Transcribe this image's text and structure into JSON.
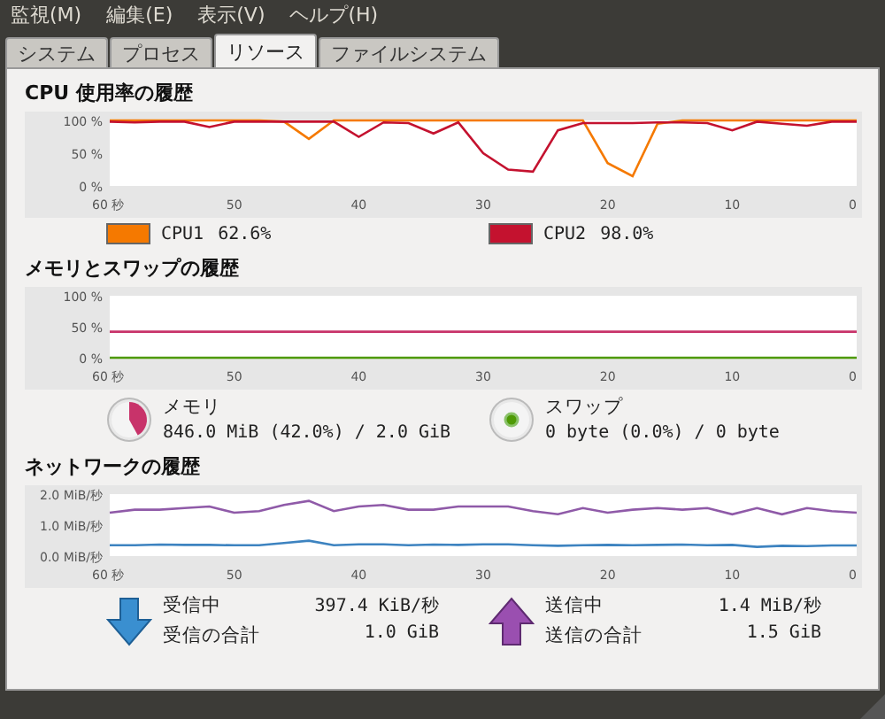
{
  "menu": [
    {
      "label": "監視(M)"
    },
    {
      "label": "編集(E)"
    },
    {
      "label": "表示(V)"
    },
    {
      "label": "ヘルプ(H)"
    }
  ],
  "tabs": [
    {
      "label": "システム",
      "selected": false
    },
    {
      "label": "プロセス",
      "selected": false
    },
    {
      "label": "リソース",
      "selected": true
    },
    {
      "label": "ファイルシステム",
      "selected": false
    }
  ],
  "cpu": {
    "title": "CPU 使用率の履歴",
    "chart_data": {
      "type": "line",
      "x": [
        60,
        58,
        56,
        54,
        52,
        50,
        48,
        46,
        44,
        42,
        40,
        38,
        36,
        34,
        32,
        30,
        28,
        26,
        24,
        22,
        20,
        18,
        16,
        14,
        12,
        10,
        8,
        6,
        4,
        2,
        0
      ],
      "xlim": [
        60,
        0
      ],
      "ylim": [
        0,
        100
      ],
      "xticks": [
        {
          "value": 60,
          "label": "60 秒"
        },
        {
          "value": 50,
          "label": "50"
        },
        {
          "value": 40,
          "label": "40"
        },
        {
          "value": 30,
          "label": "30"
        },
        {
          "value": 20,
          "label": "20"
        },
        {
          "value": 10,
          "label": "10"
        },
        {
          "value": 0,
          "label": "0"
        }
      ],
      "yticks": [
        {
          "value": 0,
          "label": "0 %"
        },
        {
          "value": 50,
          "label": "50 %"
        },
        {
          "value": 100,
          "label": "100 %"
        }
      ],
      "series": [
        {
          "name": "CPU1",
          "color": "#f57900",
          "values": [
            100,
            100,
            100,
            100,
            100,
            100,
            100,
            98,
            72,
            100,
            100,
            100,
            100,
            100,
            100,
            100,
            100,
            100,
            100,
            100,
            35,
            15,
            95,
            100,
            100,
            100,
            100,
            100,
            100,
            100,
            100
          ]
        },
        {
          "name": "CPU2",
          "color": "#c4122f",
          "values": [
            98,
            97,
            98,
            98,
            90,
            98,
            98,
            98,
            98,
            98,
            75,
            97,
            96,
            80,
            97,
            50,
            25,
            22,
            85,
            96,
            96,
            96,
            97,
            97,
            96,
            85,
            98,
            95,
            92,
            98,
            98
          ]
        }
      ]
    },
    "legend": [
      {
        "reading": "62.6%"
      },
      {
        "reading": "98.0%"
      }
    ]
  },
  "memory": {
    "title": "メモリとスワップの履歴",
    "chart_data": {
      "type": "line",
      "x": [
        60,
        0
      ],
      "xlim": [
        60,
        0
      ],
      "ylim": [
        0,
        100
      ],
      "xticks": [
        {
          "value": 60,
          "label": "60 秒"
        },
        {
          "value": 50,
          "label": "50"
        },
        {
          "value": 40,
          "label": "40"
        },
        {
          "value": 30,
          "label": "30"
        },
        {
          "value": 20,
          "label": "20"
        },
        {
          "value": 10,
          "label": "10"
        },
        {
          "value": 0,
          "label": "0"
        }
      ],
      "yticks": [
        {
          "value": 0,
          "label": "0 %"
        },
        {
          "value": 50,
          "label": "50 %"
        },
        {
          "value": 100,
          "label": "100 %"
        }
      ],
      "series": [
        {
          "name": "メモリ",
          "color": "#c8336a",
          "values": [
            42,
            42
          ]
        },
        {
          "name": "スワップ",
          "color": "#4e9a06",
          "values": [
            0,
            0
          ]
        }
      ]
    },
    "legend": [
      {
        "reading": "846.0 MiB (42.0%) / 2.0 GiB",
        "level": 0.42
      },
      {
        "reading": "0 byte (0.0%) / 0 byte"
      }
    ]
  },
  "network": {
    "title": "ネットワークの履歴",
    "chart_data": {
      "type": "line",
      "x": [
        60,
        58,
        56,
        54,
        52,
        50,
        48,
        46,
        44,
        42,
        40,
        38,
        36,
        34,
        32,
        30,
        28,
        26,
        24,
        22,
        20,
        18,
        16,
        14,
        12,
        10,
        8,
        6,
        4,
        2,
        0
      ],
      "xlim": [
        60,
        0
      ],
      "ylim": [
        0,
        2
      ],
      "xticks": [
        {
          "value": 60,
          "label": "60 秒"
        },
        {
          "value": 50,
          "label": "50"
        },
        {
          "value": 40,
          "label": "40"
        },
        {
          "value": 30,
          "label": "30"
        },
        {
          "value": 20,
          "label": "20"
        },
        {
          "value": 10,
          "label": "10"
        },
        {
          "value": 0,
          "label": "0"
        }
      ],
      "yticks": [
        {
          "value": 0,
          "label": "0.0 MiB/秒"
        },
        {
          "value": 1,
          "label": "1.0 MiB/秒"
        },
        {
          "value": 2,
          "label": "2.0 MiB/秒"
        }
      ],
      "series": [
        {
          "name": "受信中",
          "color": "#3d83c0",
          "values": [
            0.35,
            0.35,
            0.37,
            0.36,
            0.36,
            0.35,
            0.35,
            0.42,
            0.5,
            0.35,
            0.38,
            0.38,
            0.35,
            0.37,
            0.36,
            0.38,
            0.38,
            0.35,
            0.33,
            0.35,
            0.36,
            0.35,
            0.36,
            0.37,
            0.35,
            0.36,
            0.3,
            0.33,
            0.32,
            0.34,
            0.34
          ]
        },
        {
          "name": "送信中",
          "color": "#8f5aa8",
          "values": [
            1.4,
            1.5,
            1.5,
            1.55,
            1.6,
            1.4,
            1.45,
            1.65,
            1.78,
            1.45,
            1.6,
            1.65,
            1.5,
            1.5,
            1.6,
            1.6,
            1.6,
            1.45,
            1.35,
            1.55,
            1.4,
            1.5,
            1.55,
            1.5,
            1.55,
            1.35,
            1.55,
            1.35,
            1.55,
            1.45,
            1.4
          ]
        }
      ]
    },
    "legend": [
      {
        "kind": "receive",
        "rate": "397.4 KiB/秒",
        "total_label": "受信の合計",
        "total": "1.0 GiB"
      },
      {
        "kind": "send",
        "rate": "1.4 MiB/秒",
        "total_label": "送信の合計",
        "total": "1.5 GiB"
      }
    ]
  }
}
